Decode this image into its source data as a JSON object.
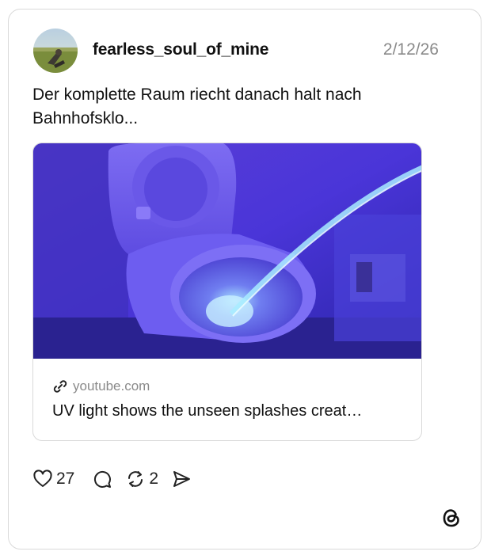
{
  "post": {
    "username": "fearless_soul_of_mine",
    "date": "2/12/26",
    "text": "Der komplette Raum riecht danach halt nach Bahnhofsklo..."
  },
  "link_preview": {
    "domain": "youtube.com",
    "title": "UV light shows the unseen splashes creat…",
    "image_icon": "uv-toilet-thumbnail"
  },
  "actions": {
    "like_count": "27",
    "repost_count": "2",
    "icons": [
      "heart-icon",
      "comment-icon",
      "repost-icon",
      "share-icon"
    ]
  },
  "brand": {
    "logo": "threads-logo",
    "accent": "#5a4cff"
  }
}
